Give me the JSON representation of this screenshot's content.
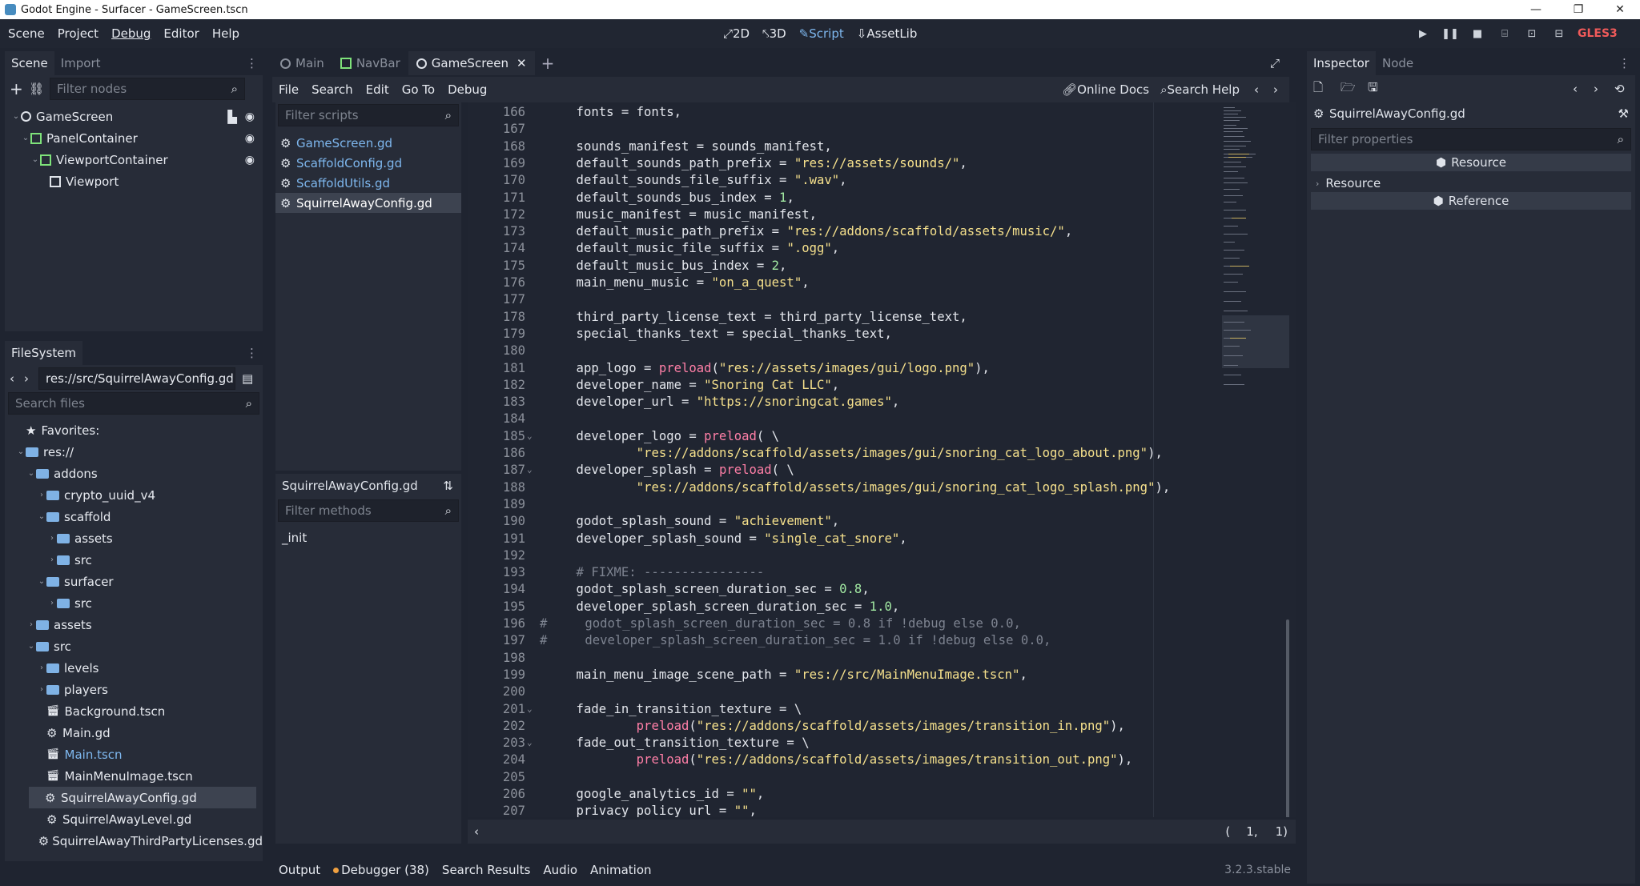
{
  "window": {
    "title": "Godot Engine - Surfacer - GameScreen.tscn",
    "controls": [
      "—",
      "❐",
      "✕"
    ]
  },
  "menus": [
    "Scene",
    "Project",
    "Debug",
    "Editor",
    "Help"
  ],
  "main_screens": [
    {
      "icon": "⤢",
      "label": "2D"
    },
    {
      "icon": "⤣",
      "label": "3D"
    },
    {
      "icon": "✎",
      "label": "Script"
    },
    {
      "icon": "⇩",
      "label": "AssetLib"
    }
  ],
  "play_buttons": [
    "▶",
    "❚❚",
    "■",
    "⌸",
    "⊡",
    "⊟"
  ],
  "renderer": "GLES3",
  "scene_dock": {
    "tabs": [
      "Scene",
      "Import"
    ],
    "filter_placeholder": "Filter nodes",
    "nodes": [
      {
        "name": "GameScreen",
        "depth": 0,
        "fold": "⌄"
      },
      {
        "name": "PanelContainer",
        "depth": 1,
        "fold": "⌄"
      },
      {
        "name": "ViewportContainer",
        "depth": 2,
        "fold": "⌄"
      },
      {
        "name": "Viewport",
        "depth": 3,
        "fold": ""
      }
    ]
  },
  "filesystem": {
    "title": "FileSystem",
    "path": "res://src/SquirrelAwayConfig.gd",
    "search_placeholder": "Search files",
    "items": [
      {
        "label": "Favorites:",
        "depth": 0,
        "type": "fav",
        "fold": ""
      },
      {
        "label": "res://",
        "depth": 0,
        "type": "folder",
        "fold": "⌄"
      },
      {
        "label": "addons",
        "depth": 1,
        "type": "folder",
        "fold": "⌄"
      },
      {
        "label": "crypto_uuid_v4",
        "depth": 2,
        "type": "folder",
        "fold": "›"
      },
      {
        "label": "scaffold",
        "depth": 2,
        "type": "folder",
        "fold": "⌄"
      },
      {
        "label": "assets",
        "depth": 3,
        "type": "folder",
        "fold": "›"
      },
      {
        "label": "src",
        "depth": 3,
        "type": "folder",
        "fold": "›"
      },
      {
        "label": "surfacer",
        "depth": 2,
        "type": "folder",
        "fold": "⌄"
      },
      {
        "label": "src",
        "depth": 3,
        "type": "folder",
        "fold": "›"
      },
      {
        "label": "assets",
        "depth": 1,
        "type": "folder",
        "fold": "›"
      },
      {
        "label": "src",
        "depth": 1,
        "type": "folder",
        "fold": "⌄"
      },
      {
        "label": "levels",
        "depth": 2,
        "type": "folder",
        "fold": "›"
      },
      {
        "label": "players",
        "depth": 2,
        "type": "folder",
        "fold": "›"
      },
      {
        "label": "Background.tscn",
        "depth": 2,
        "type": "scene",
        "fold": ""
      },
      {
        "label": "Main.gd",
        "depth": 2,
        "type": "script",
        "fold": ""
      },
      {
        "label": "Main.tscn",
        "depth": 2,
        "type": "scene-open",
        "fold": ""
      },
      {
        "label": "MainMenuImage.tscn",
        "depth": 2,
        "type": "scene",
        "fold": ""
      },
      {
        "label": "SquirrelAwayConfig.gd",
        "depth": 2,
        "type": "script",
        "fold": "",
        "selected": true
      },
      {
        "label": "SquirrelAwayLevel.gd",
        "depth": 2,
        "type": "script",
        "fold": ""
      },
      {
        "label": "SquirrelAwayThirdPartyLicenses.gd",
        "depth": 2,
        "type": "script",
        "fold": ""
      }
    ]
  },
  "scene_tabs": [
    {
      "label": "Main",
      "type": "circle"
    },
    {
      "label": "NavBar",
      "type": "ctrl"
    },
    {
      "label": "GameScreen",
      "type": "circle",
      "active": true
    }
  ],
  "script_menu": [
    "File",
    "Search",
    "Edit",
    "Go To",
    "Debug"
  ],
  "script_links": {
    "docs": "Online Docs",
    "help": "Search Help"
  },
  "scripts": {
    "filter_placeholder": "Filter scripts",
    "items": [
      {
        "label": "GameScreen.gd"
      },
      {
        "label": "ScaffoldConfig.gd"
      },
      {
        "label": "ScaffoldUtils.gd"
      },
      {
        "label": "SquirrelAwayConfig.gd",
        "active": true
      }
    ],
    "current": "SquirrelAwayConfig.gd",
    "methods_placeholder": "Filter methods",
    "methods": [
      "_init"
    ]
  },
  "code_lines": [
    {
      "n": "166",
      "f": "",
      "s": [
        [
          "t",
          "    fonts = fonts,"
        ]
      ]
    },
    {
      "n": "167",
      "f": "",
      "s": []
    },
    {
      "n": "168",
      "f": "",
      "s": [
        [
          "t",
          "    sounds_manifest = sounds_manifest,"
        ]
      ]
    },
    {
      "n": "169",
      "f": "",
      "s": [
        [
          "t",
          "    default_sounds_path_prefix = "
        ],
        [
          "str",
          "\"res://assets/sounds/\""
        ],
        [
          "t",
          ","
        ]
      ]
    },
    {
      "n": "170",
      "f": "",
      "s": [
        [
          "t",
          "    default_sounds_file_suffix = "
        ],
        [
          "str",
          "\".wav\""
        ],
        [
          "t",
          ","
        ]
      ]
    },
    {
      "n": "171",
      "f": "",
      "s": [
        [
          "t",
          "    default_sounds_bus_index = "
        ],
        [
          "num",
          "1"
        ],
        [
          "t",
          ","
        ]
      ]
    },
    {
      "n": "172",
      "f": "",
      "s": [
        [
          "t",
          "    music_manifest = music_manifest,"
        ]
      ]
    },
    {
      "n": "173",
      "f": "",
      "s": [
        [
          "t",
          "    default_music_path_prefix = "
        ],
        [
          "str",
          "\"res://addons/scaffold/assets/music/\""
        ],
        [
          "t",
          ","
        ]
      ]
    },
    {
      "n": "174",
      "f": "",
      "s": [
        [
          "t",
          "    default_music_file_suffix = "
        ],
        [
          "str",
          "\".ogg\""
        ],
        [
          "t",
          ","
        ]
      ]
    },
    {
      "n": "175",
      "f": "",
      "s": [
        [
          "t",
          "    default_music_bus_index = "
        ],
        [
          "num",
          "2"
        ],
        [
          "t",
          ","
        ]
      ]
    },
    {
      "n": "176",
      "f": "",
      "s": [
        [
          "t",
          "    main_menu_music = "
        ],
        [
          "str",
          "\"on_a_quest\""
        ],
        [
          "t",
          ","
        ]
      ]
    },
    {
      "n": "177",
      "f": "",
      "s": []
    },
    {
      "n": "178",
      "f": "",
      "s": [
        [
          "t",
          "    third_party_license_text = third_party_license_text,"
        ]
      ]
    },
    {
      "n": "179",
      "f": "",
      "s": [
        [
          "t",
          "    special_thanks_text = special_thanks_text,"
        ]
      ]
    },
    {
      "n": "180",
      "f": "",
      "s": []
    },
    {
      "n": "181",
      "f": "",
      "s": [
        [
          "t",
          "    app_logo = "
        ],
        [
          "kw",
          "preload"
        ],
        [
          "t",
          "("
        ],
        [
          "str",
          "\"res://assets/images/gui/logo.png\""
        ],
        [
          "t",
          "),"
        ]
      ]
    },
    {
      "n": "182",
      "f": "",
      "s": [
        [
          "t",
          "    developer_name = "
        ],
        [
          "str",
          "\"Snoring Cat LLC\""
        ],
        [
          "t",
          ","
        ]
      ]
    },
    {
      "n": "183",
      "f": "",
      "s": [
        [
          "t",
          "    developer_url = "
        ],
        [
          "str",
          "\"https://snoringcat.games\""
        ],
        [
          "t",
          ","
        ]
      ]
    },
    {
      "n": "184",
      "f": "",
      "s": []
    },
    {
      "n": "185",
      "f": "⌄",
      "s": [
        [
          "t",
          "    developer_logo = "
        ],
        [
          "kw",
          "preload"
        ],
        [
          "t",
          "( \\"
        ]
      ]
    },
    {
      "n": "186",
      "f": "",
      "s": [
        [
          "t",
          "            "
        ],
        [
          "str",
          "\"res://addons/scaffold/assets/images/gui/snoring_cat_logo_about.png\""
        ],
        [
          "t",
          "),"
        ]
      ]
    },
    {
      "n": "187",
      "f": "⌄",
      "s": [
        [
          "t",
          "    developer_splash = "
        ],
        [
          "kw",
          "preload"
        ],
        [
          "t",
          "( \\"
        ]
      ]
    },
    {
      "n": "188",
      "f": "",
      "s": [
        [
          "t",
          "            "
        ],
        [
          "str",
          "\"res://addons/scaffold/assets/images/gui/snoring_cat_logo_splash.png\""
        ],
        [
          "t",
          "),"
        ]
      ]
    },
    {
      "n": "189",
      "f": "",
      "s": []
    },
    {
      "n": "190",
      "f": "",
      "s": [
        [
          "t",
          "    godot_splash_sound = "
        ],
        [
          "str",
          "\"achievement\""
        ],
        [
          "t",
          ","
        ]
      ]
    },
    {
      "n": "191",
      "f": "",
      "s": [
        [
          "t",
          "    developer_splash_sound = "
        ],
        [
          "str",
          "\"single_cat_snore\""
        ],
        [
          "t",
          ","
        ]
      ]
    },
    {
      "n": "192",
      "f": "",
      "s": []
    },
    {
      "n": "193",
      "f": "",
      "s": [
        [
          "cm",
          "    # FIXME: ----------------"
        ]
      ]
    },
    {
      "n": "194",
      "f": "",
      "s": [
        [
          "t",
          "    godot_splash_screen_duration_sec = "
        ],
        [
          "num",
          "0.8"
        ],
        [
          "t",
          ","
        ]
      ]
    },
    {
      "n": "195",
      "f": "",
      "s": [
        [
          "t",
          "    developer_splash_screen_duration_sec = "
        ],
        [
          "num",
          "1.0"
        ],
        [
          "t",
          ","
        ]
      ]
    },
    {
      "n": "196",
      "f": "",
      "s": [
        [
          "cm",
          "#     godot_splash_screen_duration_sec = 0.8 if !debug else 0.0,"
        ]
      ]
    },
    {
      "n": "197",
      "f": "",
      "s": [
        [
          "cm",
          "#     developer_splash_screen_duration_sec = 1.0 if !debug else 0.0,"
        ]
      ]
    },
    {
      "n": "198",
      "f": "",
      "s": []
    },
    {
      "n": "199",
      "f": "",
      "s": [
        [
          "t",
          "    main_menu_image_scene_path = "
        ],
        [
          "str",
          "\"res://src/MainMenuImage.tscn\""
        ],
        [
          "t",
          ","
        ]
      ]
    },
    {
      "n": "200",
      "f": "",
      "s": []
    },
    {
      "n": "201",
      "f": "⌄",
      "s": [
        [
          "t",
          "    fade_in_transition_texture = \\"
        ]
      ]
    },
    {
      "n": "202",
      "f": "",
      "s": [
        [
          "t",
          "            "
        ],
        [
          "kw",
          "preload"
        ],
        [
          "t",
          "("
        ],
        [
          "str",
          "\"res://addons/scaffold/assets/images/transition_in.png\""
        ],
        [
          "t",
          "),"
        ]
      ]
    },
    {
      "n": "203",
      "f": "⌄",
      "s": [
        [
          "t",
          "    fade_out_transition_texture = \\"
        ]
      ]
    },
    {
      "n": "204",
      "f": "",
      "s": [
        [
          "t",
          "            "
        ],
        [
          "kw",
          "preload"
        ],
        [
          "t",
          "("
        ],
        [
          "str",
          "\"res://addons/scaffold/assets/images/transition_out.png\""
        ],
        [
          "t",
          "),"
        ]
      ]
    },
    {
      "n": "205",
      "f": "",
      "s": []
    },
    {
      "n": "206",
      "f": "",
      "s": [
        [
          "t",
          "    google_analytics_id = "
        ],
        [
          "str",
          "\"\""
        ],
        [
          "t",
          ","
        ]
      ]
    },
    {
      "n": "207",
      "f": "",
      "s": [
        [
          "t",
          "    privacy_policy_url = "
        ],
        [
          "str",
          "\"\""
        ],
        [
          "t",
          ","
        ]
      ]
    }
  ],
  "cursor": {
    "line": "1,",
    "col": "1)",
    "open": "("
  },
  "bottom_tabs": [
    "Output",
    "Debugger (38)",
    "Search Results",
    "Audio",
    "Animation"
  ],
  "version": "3.2.3.stable",
  "inspector": {
    "tabs": [
      "Inspector",
      "Node"
    ],
    "object": "SquirrelAwayConfig.gd",
    "filter_placeholder": "Filter properties",
    "sections": [
      "Resource",
      "Resource",
      "Reference"
    ]
  },
  "colors": {
    "accent": "#7eb7ee",
    "string": "#f5e08c",
    "number": "#a3eaa3",
    "keyword": "#ff7fa7",
    "comment": "#7d8390",
    "gles": "#f05a5a"
  }
}
